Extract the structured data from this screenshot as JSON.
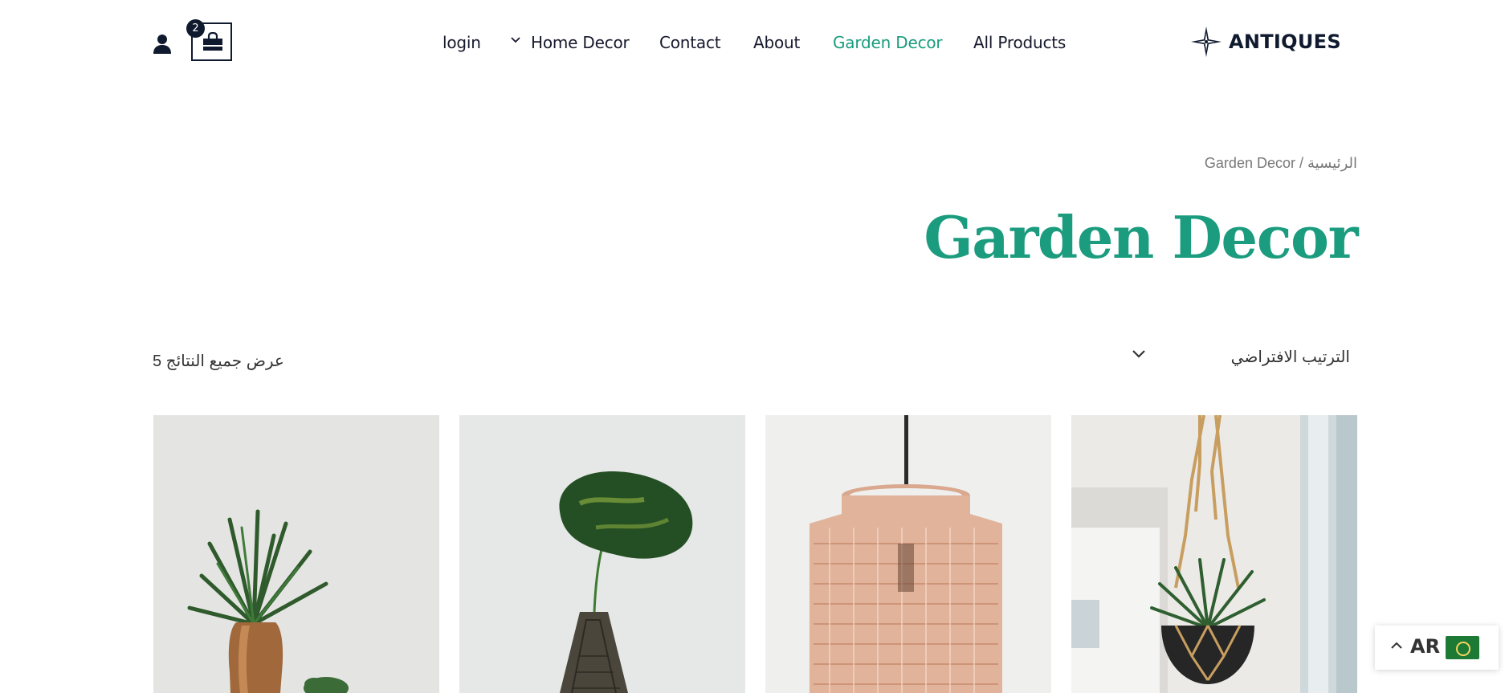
{
  "header": {
    "cart_count": "2",
    "nav": [
      {
        "label": "login",
        "active": false
      },
      {
        "label": "Home Decor",
        "active": false,
        "has_dropdown": true
      },
      {
        "label": "Contact",
        "active": false
      },
      {
        "label": "About",
        "active": false
      },
      {
        "label": "Garden Decor",
        "active": true
      },
      {
        "label": "All Products",
        "active": false
      }
    ],
    "logo_text": "ANTIQUES",
    "icons": {
      "user": "user-icon",
      "cart": "shopping-bag-icon",
      "logo": "compass-star-icon",
      "dropdown": "chevron-down-icon"
    }
  },
  "breadcrumb": {
    "home": "الرئيسية",
    "separator": " / ",
    "current": "Garden Decor"
  },
  "page": {
    "title": "Garden Decor"
  },
  "toolbar": {
    "results_text": "عرض جميع النتائج 5",
    "sort_label": "الترتيب الافتراضي"
  },
  "products": [
    {
      "image": "potted-fern-in-wooden-vase"
    },
    {
      "image": "monstera-leaf-in-geometric-vase"
    },
    {
      "image": "rattan-pendant-lamp"
    },
    {
      "image": "macrame-hanging-planter"
    }
  ],
  "language": {
    "code": "AR",
    "flag": "arab-league-flag"
  },
  "colors": {
    "accent": "#1b9c7e",
    "dark": "#0f1a2e",
    "text": "#15192c"
  }
}
